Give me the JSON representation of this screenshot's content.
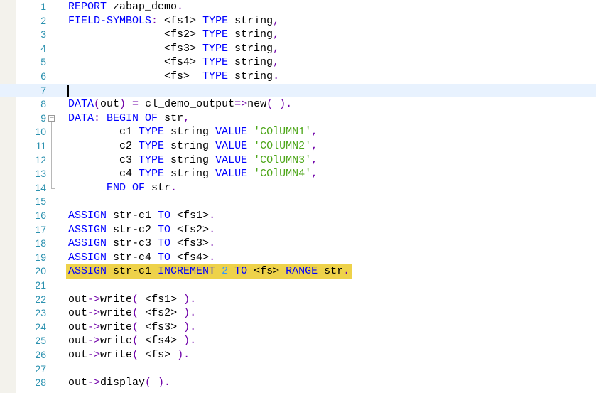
{
  "lines": [
    {
      "n": "1",
      "tokens": [
        {
          "t": "REPORT",
          "c": "kw"
        },
        {
          "t": " zabap_demo",
          "c": "pl"
        },
        {
          "t": ".",
          "c": "op"
        }
      ]
    },
    {
      "n": "2",
      "tokens": [
        {
          "t": "FIELD-SYMBOLS",
          "c": "kw"
        },
        {
          "t": ":",
          "c": "op"
        },
        {
          "t": " <fs1> ",
          "c": "pl"
        },
        {
          "t": "TYPE",
          "c": "kw"
        },
        {
          "t": " string",
          "c": "pl"
        },
        {
          "t": ",",
          "c": "op"
        }
      ]
    },
    {
      "n": "3",
      "tokens": [
        {
          "t": "               <fs2> ",
          "c": "pl"
        },
        {
          "t": "TYPE",
          "c": "kw"
        },
        {
          "t": " string",
          "c": "pl"
        },
        {
          "t": ",",
          "c": "op"
        }
      ]
    },
    {
      "n": "4",
      "tokens": [
        {
          "t": "               <fs3> ",
          "c": "pl"
        },
        {
          "t": "TYPE",
          "c": "kw"
        },
        {
          "t": " string",
          "c": "pl"
        },
        {
          "t": ",",
          "c": "op"
        }
      ]
    },
    {
      "n": "5",
      "tokens": [
        {
          "t": "               <fs4> ",
          "c": "pl"
        },
        {
          "t": "TYPE",
          "c": "kw"
        },
        {
          "t": " string",
          "c": "pl"
        },
        {
          "t": ",",
          "c": "op"
        }
      ]
    },
    {
      "n": "6",
      "tokens": [
        {
          "t": "               <fs>  ",
          "c": "pl"
        },
        {
          "t": "TYPE",
          "c": "kw"
        },
        {
          "t": " string",
          "c": "pl"
        },
        {
          "t": ".",
          "c": "op"
        }
      ]
    },
    {
      "n": "7",
      "current": true,
      "cursor": true,
      "tokens": []
    },
    {
      "n": "8",
      "tokens": [
        {
          "t": "DATA",
          "c": "kw"
        },
        {
          "t": "(",
          "c": "op"
        },
        {
          "t": "out",
          "c": "pl"
        },
        {
          "t": ") = ",
          "c": "op"
        },
        {
          "t": "cl_demo_output",
          "c": "pl"
        },
        {
          "t": "=>",
          "c": "op"
        },
        {
          "t": "new",
          "c": "pl"
        },
        {
          "t": "( ).",
          "c": "op"
        }
      ]
    },
    {
      "n": "9",
      "fold": true,
      "tokens": [
        {
          "t": "DATA",
          "c": "kw"
        },
        {
          "t": ":",
          "c": "op"
        },
        {
          "t": " ",
          "c": "pl"
        },
        {
          "t": "BEGIN OF",
          "c": "kw"
        },
        {
          "t": " str",
          "c": "pl"
        },
        {
          "t": ",",
          "c": "op"
        }
      ]
    },
    {
      "n": "10",
      "tokens": [
        {
          "t": "        c1 ",
          "c": "pl"
        },
        {
          "t": "TYPE",
          "c": "kw"
        },
        {
          "t": " string ",
          "c": "pl"
        },
        {
          "t": "VALUE",
          "c": "kw"
        },
        {
          "t": " ",
          "c": "pl"
        },
        {
          "t": "'COlUMN1'",
          "c": "st"
        },
        {
          "t": ",",
          "c": "op"
        }
      ]
    },
    {
      "n": "11",
      "tokens": [
        {
          "t": "        c2 ",
          "c": "pl"
        },
        {
          "t": "TYPE",
          "c": "kw"
        },
        {
          "t": " string ",
          "c": "pl"
        },
        {
          "t": "VALUE",
          "c": "kw"
        },
        {
          "t": " ",
          "c": "pl"
        },
        {
          "t": "'COlUMN2'",
          "c": "st"
        },
        {
          "t": ",",
          "c": "op"
        }
      ]
    },
    {
      "n": "12",
      "tokens": [
        {
          "t": "        c3 ",
          "c": "pl"
        },
        {
          "t": "TYPE",
          "c": "kw"
        },
        {
          "t": " string ",
          "c": "pl"
        },
        {
          "t": "VALUE",
          "c": "kw"
        },
        {
          "t": " ",
          "c": "pl"
        },
        {
          "t": "'COlUMN3'",
          "c": "st"
        },
        {
          "t": ",",
          "c": "op"
        }
      ]
    },
    {
      "n": "13",
      "tokens": [
        {
          "t": "        c4 ",
          "c": "pl"
        },
        {
          "t": "TYPE",
          "c": "kw"
        },
        {
          "t": " string ",
          "c": "pl"
        },
        {
          "t": "VALUE",
          "c": "kw"
        },
        {
          "t": " ",
          "c": "pl"
        },
        {
          "t": "'COlUMN4'",
          "c": "st"
        },
        {
          "t": ",",
          "c": "op"
        }
      ]
    },
    {
      "n": "14",
      "tokens": [
        {
          "t": "      ",
          "c": "pl"
        },
        {
          "t": "END OF",
          "c": "kw"
        },
        {
          "t": " str",
          "c": "pl"
        },
        {
          "t": ".",
          "c": "op"
        }
      ]
    },
    {
      "n": "15",
      "tokens": []
    },
    {
      "n": "16",
      "tokens": [
        {
          "t": "ASSIGN",
          "c": "kw"
        },
        {
          "t": " str-c1 ",
          "c": "pl"
        },
        {
          "t": "TO",
          "c": "kw"
        },
        {
          "t": " <fs1>",
          "c": "pl"
        },
        {
          "t": ".",
          "c": "op"
        }
      ]
    },
    {
      "n": "17",
      "tokens": [
        {
          "t": "ASSIGN",
          "c": "kw"
        },
        {
          "t": " str-c2 ",
          "c": "pl"
        },
        {
          "t": "TO",
          "c": "kw"
        },
        {
          "t": " <fs2>",
          "c": "pl"
        },
        {
          "t": ".",
          "c": "op"
        }
      ]
    },
    {
      "n": "18",
      "tokens": [
        {
          "t": "ASSIGN",
          "c": "kw"
        },
        {
          "t": " str-c3 ",
          "c": "pl"
        },
        {
          "t": "TO",
          "c": "kw"
        },
        {
          "t": " <fs3>",
          "c": "pl"
        },
        {
          "t": ".",
          "c": "op"
        }
      ]
    },
    {
      "n": "19",
      "tokens": [
        {
          "t": "ASSIGN",
          "c": "kw"
        },
        {
          "t": " str-c4 ",
          "c": "pl"
        },
        {
          "t": "TO",
          "c": "kw"
        },
        {
          "t": " <fs4>",
          "c": "pl"
        },
        {
          "t": ".",
          "c": "op"
        }
      ]
    },
    {
      "n": "20",
      "highlight": true,
      "tokens": [
        {
          "t": "ASSIGN",
          "c": "kw"
        },
        {
          "t": " str-c1 ",
          "c": "pl"
        },
        {
          "t": "INCREMENT",
          "c": "kw"
        },
        {
          "t": " ",
          "c": "pl"
        },
        {
          "t": "2",
          "c": "nm"
        },
        {
          "t": " ",
          "c": "pl"
        },
        {
          "t": "TO",
          "c": "kw"
        },
        {
          "t": " <fs> ",
          "c": "pl"
        },
        {
          "t": "RANGE",
          "c": "kw"
        },
        {
          "t": " str",
          "c": "pl"
        },
        {
          "t": ".",
          "c": "op"
        }
      ]
    },
    {
      "n": "21",
      "tokens": []
    },
    {
      "n": "22",
      "tokens": [
        {
          "t": "out",
          "c": "pl"
        },
        {
          "t": "->",
          "c": "op"
        },
        {
          "t": "write",
          "c": "pl"
        },
        {
          "t": "( ",
          "c": "op"
        },
        {
          "t": "<fs1> ",
          "c": "pl"
        },
        {
          "t": ").",
          "c": "op"
        }
      ]
    },
    {
      "n": "23",
      "tokens": [
        {
          "t": "out",
          "c": "pl"
        },
        {
          "t": "->",
          "c": "op"
        },
        {
          "t": "write",
          "c": "pl"
        },
        {
          "t": "( ",
          "c": "op"
        },
        {
          "t": "<fs2> ",
          "c": "pl"
        },
        {
          "t": ").",
          "c": "op"
        }
      ]
    },
    {
      "n": "24",
      "tokens": [
        {
          "t": "out",
          "c": "pl"
        },
        {
          "t": "->",
          "c": "op"
        },
        {
          "t": "write",
          "c": "pl"
        },
        {
          "t": "( ",
          "c": "op"
        },
        {
          "t": "<fs3> ",
          "c": "pl"
        },
        {
          "t": ").",
          "c": "op"
        }
      ]
    },
    {
      "n": "25",
      "tokens": [
        {
          "t": "out",
          "c": "pl"
        },
        {
          "t": "->",
          "c": "op"
        },
        {
          "t": "write",
          "c": "pl"
        },
        {
          "t": "( ",
          "c": "op"
        },
        {
          "t": "<fs4> ",
          "c": "pl"
        },
        {
          "t": ").",
          "c": "op"
        }
      ]
    },
    {
      "n": "26",
      "tokens": [
        {
          "t": "out",
          "c": "pl"
        },
        {
          "t": "->",
          "c": "op"
        },
        {
          "t": "write",
          "c": "pl"
        },
        {
          "t": "( ",
          "c": "op"
        },
        {
          "t": "<fs> ",
          "c": "pl"
        },
        {
          "t": ").",
          "c": "op"
        }
      ]
    },
    {
      "n": "27",
      "tokens": []
    },
    {
      "n": "28",
      "tokens": [
        {
          "t": "out",
          "c": "pl"
        },
        {
          "t": "->",
          "c": "op"
        },
        {
          "t": "display",
          "c": "pl"
        },
        {
          "t": "( ).",
          "c": "op"
        }
      ]
    }
  ],
  "colors": {
    "keyword": "#0000ff",
    "string_literal": "#4da619",
    "number_literal": "#3399ff",
    "operator": "#6f00a8",
    "line_number": "#2b91af",
    "current_line": "#e8f2fe",
    "highlight": "#eed24a"
  },
  "icons": {
    "fold_toggle": "minus-box-icon"
  }
}
